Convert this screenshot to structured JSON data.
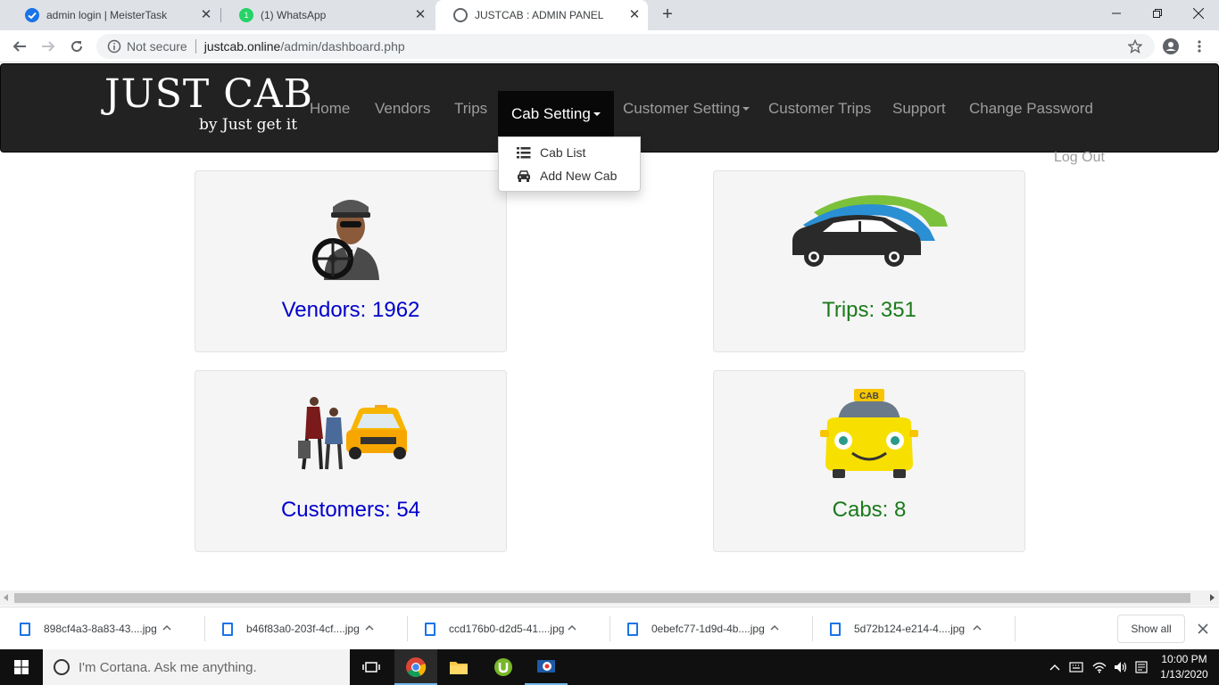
{
  "browser": {
    "tabs": [
      {
        "title": "admin login | MeisterTask",
        "active": false
      },
      {
        "title": "(1) WhatsApp",
        "active": false
      },
      {
        "title": "JUSTCAB : ADMIN PANEL",
        "active": true
      }
    ],
    "security_label": "Not secure",
    "url_host": "justcab.online",
    "url_path": "/admin/dashboard.php"
  },
  "site": {
    "logo_main": "JUST CAB",
    "logo_tagline": "by Just get it",
    "nav": {
      "home": "Home",
      "vendors": "Vendors",
      "trips": "Trips",
      "cab_setting": "Cab Setting",
      "customer_setting": "Customer Setting",
      "customer_trips": "Customer Trips",
      "support": "Support",
      "change_password": "Change Password",
      "logout": "Log Out"
    },
    "dropdown": {
      "cab_list": "Cab List",
      "add_new_cab": "Add New Cab"
    }
  },
  "stats": {
    "vendors": "Vendors: 1962",
    "trips": "Trips: 351",
    "customers": "Customers: 54",
    "cabs": "Cabs: 8",
    "cab_sign": "CAB"
  },
  "downloads": {
    "items": [
      "898cf4a3-8a83-43....jpg",
      "b46f83a0-203f-4cf....jpg",
      "ccd176b0-d2d5-41....jpg",
      "0ebefc77-1d9d-4b....jpg",
      "5d72b124-e214-4....jpg"
    ],
    "show_all": "Show all"
  },
  "taskbar": {
    "cortana_placeholder": "I'm Cortana. Ask me anything.",
    "time": "10:00 PM",
    "date": "1/13/2020"
  },
  "colors": {
    "navbar": "#222222",
    "link_blue": "#0000cd",
    "link_green": "#1a7a1a",
    "card_bg": "#f5f5f5"
  }
}
